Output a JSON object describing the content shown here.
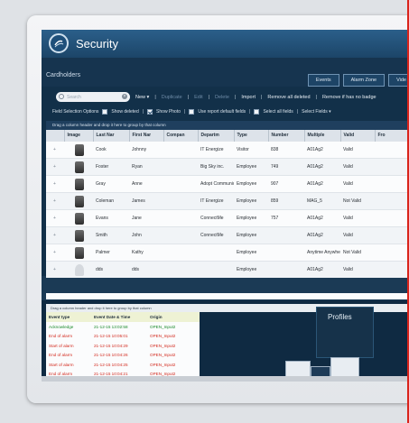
{
  "app": {
    "title": "Security"
  },
  "nav": {
    "buttons": [
      "Events",
      "Alarm Zone",
      "Vide"
    ]
  },
  "section": {
    "title": "Cardholders"
  },
  "toolbar": {
    "search_placeholder": "Search",
    "actions": [
      "New",
      "Duplicate",
      "Edit",
      "Delete",
      "Import",
      "Remove all deleted",
      "Remove if has no badge"
    ]
  },
  "options": {
    "label": "Field Selection Options",
    "show_deleted": {
      "label": "Show deleted",
      "checked": false
    },
    "show_photo": {
      "label": "Show Photo",
      "checked": true
    },
    "use_report_default": {
      "label": "Use report default fields",
      "checked": false
    },
    "select_all": {
      "label": "Select all fields",
      "checked": false
    },
    "select_fields": "Select Fields"
  },
  "grid": {
    "group_hint": "Drag a column header and drop it here to group by that column",
    "columns": [
      "Image",
      "Last Nar",
      "First Nar",
      "Compan",
      "Departm",
      "Type",
      "Number",
      "Multiple",
      "Valid",
      "Fro"
    ],
    "rows": [
      {
        "last": "Cook",
        "first": "Johnny",
        "company": "",
        "dept": "IT Energize",
        "type": "Visitor",
        "number": "838",
        "multiple": "A01Ag2",
        "valid": "Valid",
        "photo": true
      },
      {
        "last": "Foster",
        "first": "Ryan",
        "company": "",
        "dept": "Big Sky inc.",
        "type": "Employee",
        "number": "749",
        "multiple": "A01Ag2",
        "valid": "Valid",
        "photo": true
      },
      {
        "last": "Gray",
        "first": "Anne",
        "company": "",
        "dept": "Adopt Communic",
        "type": "Employee",
        "number": "907",
        "multiple": "A01Ag2",
        "valid": "Valid",
        "photo": true
      },
      {
        "last": "Coleman",
        "first": "James",
        "company": "",
        "dept": "IT Energize",
        "type": "Employee",
        "number": "859",
        "multiple": "MAG_5",
        "valid": "Not Valid",
        "photo": true
      },
      {
        "last": "Evans",
        "first": "Jane",
        "company": "",
        "dept": "ConnectMe",
        "type": "Employee",
        "number": "757",
        "multiple": "A01Ag2",
        "valid": "Valid",
        "photo": true
      },
      {
        "last": "Smith",
        "first": "John",
        "company": "",
        "dept": "ConnectMe",
        "type": "Employee",
        "number": "",
        "multiple": "A01Ag2",
        "valid": "Valid",
        "photo": true
      },
      {
        "last": "Palmer",
        "first": "Kathy",
        "company": "",
        "dept": "",
        "type": "Employee",
        "number": "",
        "multiple": "Anytime Anywher",
        "valid": "Not Valid",
        "photo": true
      },
      {
        "last": "dds",
        "first": "dds",
        "company": "",
        "dept": "",
        "type": "Employee",
        "number": "",
        "multiple": "A01Ag2",
        "valid": "Valid",
        "photo": false
      }
    ]
  },
  "events": {
    "group_hint": "Drag a column header and drop it here to group by that column",
    "columns": [
      "Event type",
      "Event Date & Time",
      "Origin"
    ],
    "rows": [
      {
        "type": "Acknowledge",
        "time": "21-12-15 13:02:58",
        "origin": "OPEN_Input2",
        "color": "#1a8a2a"
      },
      {
        "type": "End of alarm",
        "time": "21-12-15 10:05:01",
        "origin": "OPEN_Input2",
        "color": "#d32a1e"
      },
      {
        "type": "Start of alarm",
        "time": "21-12-15 10:04:29",
        "origin": "OPEN_Input2",
        "color": "#d32a1e"
      },
      {
        "type": "End of alarm",
        "time": "21-12-15 10:04:26",
        "origin": "OPEN_Input2",
        "color": "#d32a1e"
      },
      {
        "type": "Start of alarm",
        "time": "21-12-15 10:04:25",
        "origin": "OPEN_Input2",
        "color": "#d32a1e"
      },
      {
        "type": "End of alarm",
        "time": "21-12-15 10:04:21",
        "origin": "OPEN_Input2",
        "color": "#d32a1e"
      }
    ]
  },
  "profiles": {
    "label": "Profiles"
  }
}
